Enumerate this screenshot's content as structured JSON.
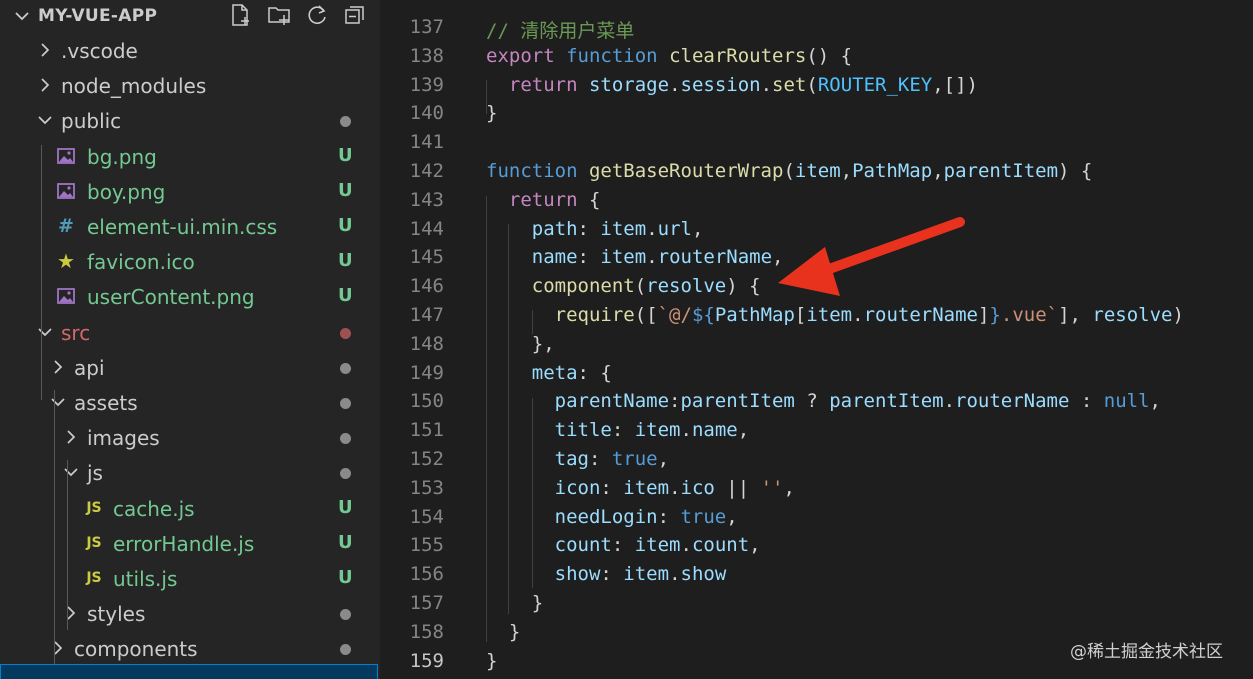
{
  "explorer": {
    "title": "MY-VUE-APP",
    "actions": [
      "new-file-icon",
      "new-folder-icon",
      "refresh-icon",
      "collapse-all-icon"
    ],
    "items": [
      {
        "label": ".vscode",
        "kind": "folder",
        "expanded": false,
        "status": ""
      },
      {
        "label": "node_modules",
        "kind": "folder",
        "expanded": false,
        "status": ""
      },
      {
        "label": "public",
        "kind": "folder",
        "expanded": true,
        "status": "dot"
      },
      {
        "label": "bg.png",
        "kind": "image",
        "status": "U"
      },
      {
        "label": "boy.png",
        "kind": "image",
        "status": "U"
      },
      {
        "label": "element-ui.min.css",
        "kind": "css",
        "icon_text": "#",
        "status": "U"
      },
      {
        "label": "favicon.ico",
        "kind": "star",
        "icon_text": "★",
        "status": "U"
      },
      {
        "label": "userContent.png",
        "kind": "image",
        "status": "U"
      },
      {
        "label": "src",
        "kind": "folder",
        "expanded": true,
        "status": "dot-red"
      },
      {
        "label": "api",
        "kind": "folder",
        "expanded": false,
        "status": "dot"
      },
      {
        "label": "assets",
        "kind": "folder",
        "expanded": true,
        "status": "dot"
      },
      {
        "label": "images",
        "kind": "folder",
        "expanded": false,
        "status": "dot"
      },
      {
        "label": "js",
        "kind": "folder",
        "expanded": true,
        "status": "dot"
      },
      {
        "label": "cache.js",
        "kind": "js",
        "icon_text": "JS",
        "status": "U"
      },
      {
        "label": "errorHandle.js",
        "kind": "js",
        "icon_text": "JS",
        "status": "U"
      },
      {
        "label": "utils.js",
        "kind": "js",
        "icon_text": "JS",
        "status": "U"
      },
      {
        "label": "styles",
        "kind": "folder",
        "expanded": false,
        "status": "dot"
      },
      {
        "label": "components",
        "kind": "folder",
        "expanded": false,
        "status": "dot"
      }
    ]
  },
  "editor": {
    "line_numbers": [
      "137",
      "138",
      "139",
      "140",
      "141",
      "142",
      "143",
      "144",
      "145",
      "146",
      "147",
      "148",
      "149",
      "150",
      "151",
      "152",
      "153",
      "154",
      "155",
      "156",
      "157",
      "158",
      "159"
    ],
    "lines": [
      [
        [
          "// 清除用户菜单",
          "comment"
        ]
      ],
      [
        [
          "export",
          "ctrl"
        ],
        [
          " ",
          ""
        ],
        [
          "function",
          "kw"
        ],
        [
          " ",
          ""
        ],
        [
          "clearRouters",
          "fn"
        ],
        [
          "() {",
          ""
        ]
      ],
      [
        [
          "  ",
          ""
        ],
        [
          "return",
          "ctrl"
        ],
        [
          " ",
          ""
        ],
        [
          "storage",
          "var"
        ],
        [
          ".",
          ""
        ],
        [
          "session",
          "var"
        ],
        [
          ".",
          ""
        ],
        [
          "set",
          "fn"
        ],
        [
          "(",
          ""
        ],
        [
          "ROUTER_KEY",
          "const"
        ],
        [
          ",[])",
          ""
        ]
      ],
      [
        [
          "}",
          ""
        ]
      ],
      [],
      [
        [
          "function",
          "kw"
        ],
        [
          " ",
          ""
        ],
        [
          "getBaseRouterWrap",
          "fn"
        ],
        [
          "(",
          ""
        ],
        [
          "item",
          "var"
        ],
        [
          ",",
          ""
        ],
        [
          "PathMap",
          "var"
        ],
        [
          ",",
          ""
        ],
        [
          "parentItem",
          "var"
        ],
        [
          ") {",
          ""
        ]
      ],
      [
        [
          "  ",
          ""
        ],
        [
          "return",
          "ctrl"
        ],
        [
          " {",
          ""
        ]
      ],
      [
        [
          "    ",
          ""
        ],
        [
          "path",
          "var"
        ],
        [
          ": ",
          ""
        ],
        [
          "item",
          "var"
        ],
        [
          ".",
          ""
        ],
        [
          "url",
          "var"
        ],
        [
          ",",
          ""
        ]
      ],
      [
        [
          "    ",
          ""
        ],
        [
          "name",
          "var"
        ],
        [
          ": ",
          ""
        ],
        [
          "item",
          "var"
        ],
        [
          ".",
          ""
        ],
        [
          "routerName",
          "var"
        ],
        [
          ",",
          ""
        ]
      ],
      [
        [
          "    ",
          ""
        ],
        [
          "component",
          "fn"
        ],
        [
          "(",
          ""
        ],
        [
          "resolve",
          "var"
        ],
        [
          ") {",
          ""
        ]
      ],
      [
        [
          "      ",
          ""
        ],
        [
          "require",
          "fn"
        ],
        [
          "([",
          ""
        ],
        [
          "`@/",
          "str"
        ],
        [
          "${",
          "tmpl"
        ],
        [
          "PathMap",
          "var"
        ],
        [
          "[",
          ""
        ],
        [
          "item",
          "var"
        ],
        [
          ".",
          ""
        ],
        [
          "routerName",
          "var"
        ],
        [
          "]",
          ""
        ],
        [
          "}",
          "tmpl"
        ],
        [
          ".vue`",
          "str"
        ],
        [
          "], ",
          ""
        ],
        [
          "resolve",
          "var"
        ],
        [
          ")",
          ""
        ]
      ],
      [
        [
          "    },",
          ""
        ]
      ],
      [
        [
          "    ",
          ""
        ],
        [
          "meta",
          "var"
        ],
        [
          ": {",
          ""
        ]
      ],
      [
        [
          "      ",
          ""
        ],
        [
          "parentName",
          "var"
        ],
        [
          ":",
          ""
        ],
        [
          "parentItem",
          "var"
        ],
        [
          " ? ",
          ""
        ],
        [
          "parentItem",
          "var"
        ],
        [
          ".",
          ""
        ],
        [
          "routerName",
          "var"
        ],
        [
          " : ",
          ""
        ],
        [
          "null",
          "kw"
        ],
        [
          ",",
          ""
        ]
      ],
      [
        [
          "      ",
          ""
        ],
        [
          "title",
          "var"
        ],
        [
          ": ",
          ""
        ],
        [
          "item",
          "var"
        ],
        [
          ".",
          ""
        ],
        [
          "name",
          "var"
        ],
        [
          ",",
          ""
        ]
      ],
      [
        [
          "      ",
          ""
        ],
        [
          "tag",
          "var"
        ],
        [
          ": ",
          ""
        ],
        [
          "true",
          "kw"
        ],
        [
          ",",
          ""
        ]
      ],
      [
        [
          "      ",
          ""
        ],
        [
          "icon",
          "var"
        ],
        [
          ": ",
          ""
        ],
        [
          "item",
          "var"
        ],
        [
          ".",
          ""
        ],
        [
          "ico",
          "var"
        ],
        [
          " || ",
          ""
        ],
        [
          "''",
          "str"
        ],
        [
          ",",
          ""
        ]
      ],
      [
        [
          "      ",
          ""
        ],
        [
          "needLogin",
          "var"
        ],
        [
          ": ",
          ""
        ],
        [
          "true",
          "kw"
        ],
        [
          ",",
          ""
        ]
      ],
      [
        [
          "      ",
          ""
        ],
        [
          "count",
          "var"
        ],
        [
          ": ",
          ""
        ],
        [
          "item",
          "var"
        ],
        [
          ".",
          ""
        ],
        [
          "count",
          "var"
        ],
        [
          ",",
          ""
        ]
      ],
      [
        [
          "      ",
          ""
        ],
        [
          "show",
          "var"
        ],
        [
          ": ",
          ""
        ],
        [
          "item",
          "var"
        ],
        [
          ".",
          ""
        ],
        [
          "show",
          "var"
        ]
      ],
      [
        [
          "    }",
          ""
        ]
      ],
      [
        [
          "  }",
          ""
        ]
      ],
      [
        [
          "}",
          ""
        ]
      ]
    ]
  },
  "watermark": "@稀土掘金技术社区",
  "colors": {
    "sidebar_bg": "#252526",
    "editor_bg": "#1e1e1e",
    "untracked": "#73c991",
    "arrow": "#e8321e"
  }
}
